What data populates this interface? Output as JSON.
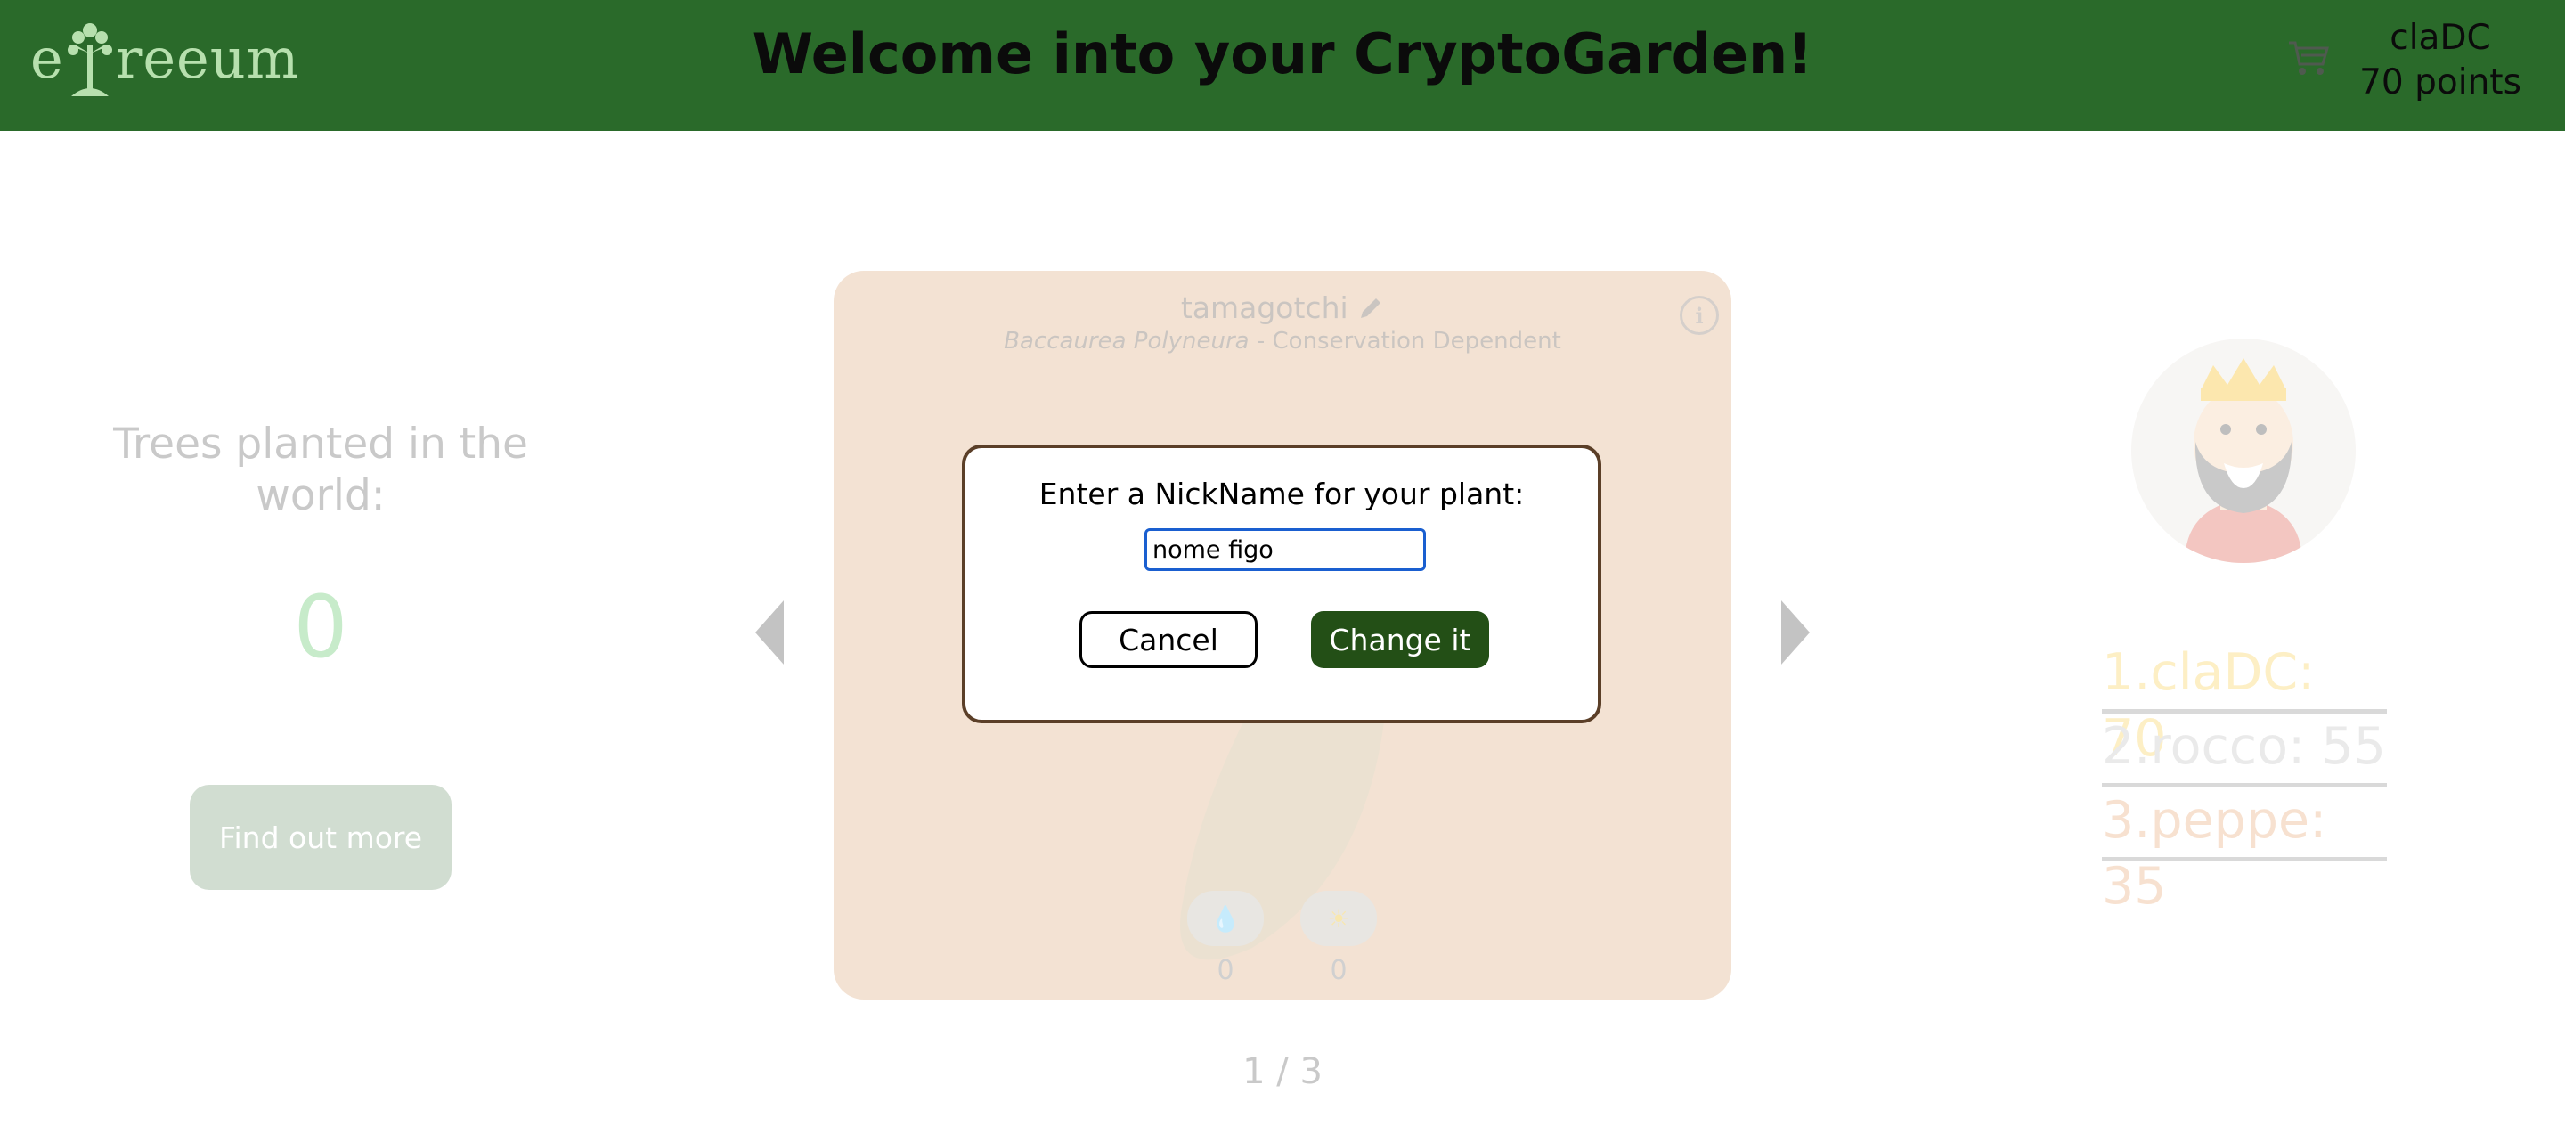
{
  "header": {
    "logo_prefix": "e",
    "logo_suffix": "reeum",
    "title": "Welcome into your CryptoGarden!",
    "cart_icon": "cart-icon",
    "user_name": "claDC",
    "user_points": "70 points"
  },
  "left_panel": {
    "label": "Trees planted in the world:",
    "count": "0",
    "button": "Find out more"
  },
  "plant_card": {
    "name": "tamagotchi",
    "edit_icon": "pencil-icon",
    "species": "Baccaurea Polyneura",
    "status": " - Conservation Dependent",
    "info_label": "i",
    "water_icon": "water-drop-icon",
    "water_count": "0",
    "sun_icon": "sun-icon",
    "sun_count": "0"
  },
  "pager": "1 / 3",
  "leaderboard": [
    {
      "text": "1.claDC: 70"
    },
    {
      "text": "2.rocco: 55"
    },
    {
      "text": "3.peppe: 35"
    }
  ],
  "modal": {
    "title": "Enter a NickName for your plant:",
    "input_value": "nome figo",
    "cancel": "Cancel",
    "confirm": "Change it"
  },
  "colors": {
    "header_bg": "#2a6a2a",
    "card_bg": "#d9a574",
    "confirm_bg": "#234f16",
    "modal_border": "#5b3f28"
  }
}
